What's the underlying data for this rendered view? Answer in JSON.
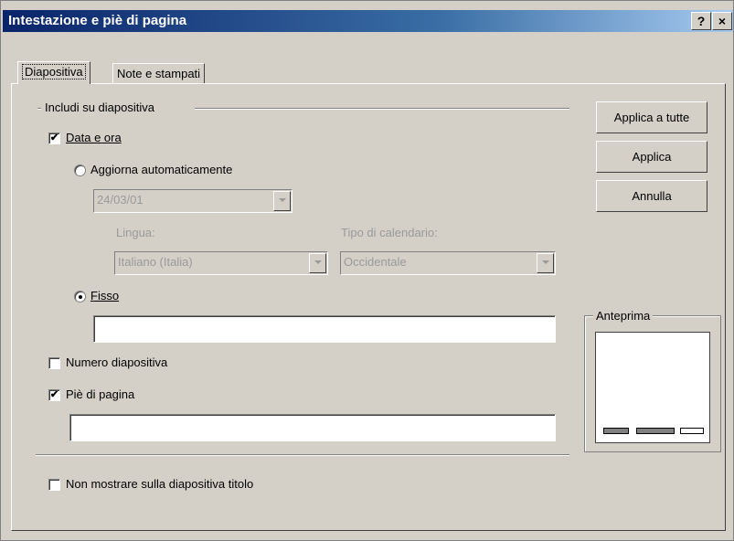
{
  "window": {
    "title": "Intestazione e piè di pagina",
    "help_glyph": "?",
    "close_glyph": "×"
  },
  "tabs": [
    {
      "label": "Diapositiva",
      "active": true
    },
    {
      "label": "Note e stampati",
      "active": false
    }
  ],
  "group": {
    "title": "Includi su diapositiva"
  },
  "date_time": {
    "checkbox_label": "Data e ora",
    "checked": true,
    "auto_radio_label": "Aggiorna automaticamente",
    "auto_selected": false,
    "date_value": "24/03/01",
    "language_label": "Lingua:",
    "language_value": "Italiano (Italia)",
    "calendar_label": "Tipo di calendario:",
    "calendar_value": "Occidentale",
    "fixed_radio_label": "Fisso",
    "fixed_selected": true,
    "fixed_value": ""
  },
  "slide_number": {
    "label": "Numero diapositiva",
    "checked": false
  },
  "footer": {
    "label": "Piè di pagina",
    "checked": true,
    "value": ""
  },
  "no_title_slide": {
    "label": "Non mostrare sulla diapositiva titolo",
    "checked": false
  },
  "buttons": {
    "apply_all": "Applica a tutte",
    "apply": "Applica",
    "cancel": "Annulla"
  },
  "preview": {
    "title": "Anteprima"
  },
  "checkmark": "✔"
}
